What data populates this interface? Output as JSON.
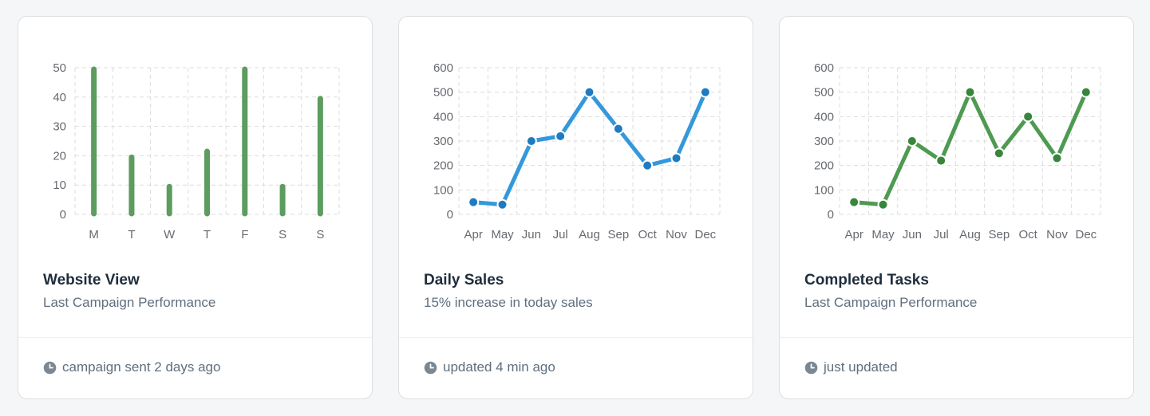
{
  "cards": [
    {
      "title": "Website View",
      "subtitle": "Last Campaign Performance",
      "footer": "campaign sent 2 days ago",
      "icon": "clock-icon"
    },
    {
      "title": "Daily Sales",
      "subtitle": "15% increase in today sales",
      "footer": "updated 4 min ago",
      "icon": "clock-icon"
    },
    {
      "title": "Completed Tasks",
      "subtitle": "Last Campaign Performance",
      "footer": "just updated",
      "icon": "clock-icon"
    }
  ],
  "colors": {
    "bars": "#5c9c5e",
    "sales_line": "#3498db",
    "sales_point": "#1f7bc1",
    "tasks_line": "#4e9a51",
    "tasks_point": "#37863b",
    "grid": "#dddddd",
    "ticks": "#666a70",
    "icon": "#7b8894"
  },
  "chart_data": [
    {
      "type": "bar",
      "categories": [
        "M",
        "T",
        "W",
        "T",
        "F",
        "S",
        "S"
      ],
      "values": [
        50,
        20,
        10,
        22,
        50,
        10,
        40
      ],
      "yticks": [
        0,
        10,
        20,
        30,
        40,
        50
      ],
      "ylim": [
        0,
        50
      ],
      "grid": true,
      "legend": "none"
    },
    {
      "type": "line",
      "categories": [
        "Apr",
        "May",
        "Jun",
        "Jul",
        "Aug",
        "Sep",
        "Oct",
        "Nov",
        "Dec"
      ],
      "values": [
        50,
        40,
        300,
        320,
        500,
        350,
        200,
        230,
        500
      ],
      "yticks": [
        0,
        100,
        200,
        300,
        400,
        500,
        600
      ],
      "ylim": [
        0,
        600
      ],
      "grid": true,
      "legend": "none"
    },
    {
      "type": "line",
      "categories": [
        "Apr",
        "May",
        "Jun",
        "Jul",
        "Aug",
        "Sep",
        "Oct",
        "Nov",
        "Dec"
      ],
      "values": [
        50,
        40,
        300,
        220,
        500,
        250,
        400,
        230,
        500
      ],
      "yticks": [
        0,
        100,
        200,
        300,
        400,
        500,
        600
      ],
      "ylim": [
        0,
        600
      ],
      "grid": true,
      "legend": "none"
    }
  ]
}
